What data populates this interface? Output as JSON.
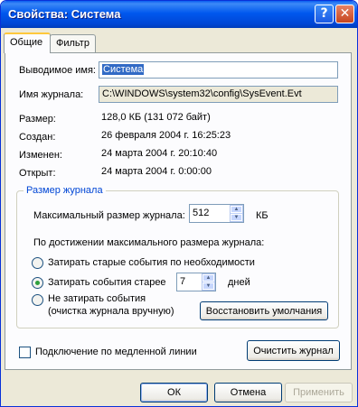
{
  "window": {
    "title": "Свойства: Система"
  },
  "tabs": [
    {
      "label": "Общие"
    },
    {
      "label": "Фильтр"
    }
  ],
  "fields": {
    "display_name_label": "Выводимое имя:",
    "display_name_value": "Система",
    "log_name_label": "Имя журнала:",
    "log_name_value": "C:\\WINDOWS\\system32\\config\\SysEvent.Evt"
  },
  "info": {
    "size_label": "Размер:",
    "size_value": "128,0 КБ (131 072 байт)",
    "created_label": "Создан:",
    "created_value": "26 февраля 2004 г. 16:25:23",
    "modified_label": "Изменен:",
    "modified_value": "24 марта 2004 г. 20:10:40",
    "opened_label": "Открыт:",
    "opened_value": "24 марта 2004 г. 0:00:00"
  },
  "log_size": {
    "group_title": "Размер журнала",
    "max_size_label": "Максимальный размер журнала:",
    "max_size_value": "512",
    "max_size_unit": "КБ",
    "on_reach_label": "По достижении максимального размера журнала:",
    "option_overwrite_as_needed": "Затирать старые события по необходимости",
    "option_overwrite_older": "Затирать события старее",
    "days_value": "7",
    "days_unit": "дней",
    "option_no_overwrite": "Не затирать события",
    "option_no_overwrite_note": "(очистка журнала вручную)",
    "restore_defaults": "Восстановить умолчания"
  },
  "slow_link": {
    "label": "Подключение по медленной линии",
    "checked": false
  },
  "buttons": {
    "clear_log": "Очистить журнал",
    "ok": "ОК",
    "cancel": "Отмена",
    "apply": "Применить"
  },
  "icons": {
    "help": "?",
    "close": "✕",
    "spin_up": "▲",
    "spin_down": "▼"
  }
}
